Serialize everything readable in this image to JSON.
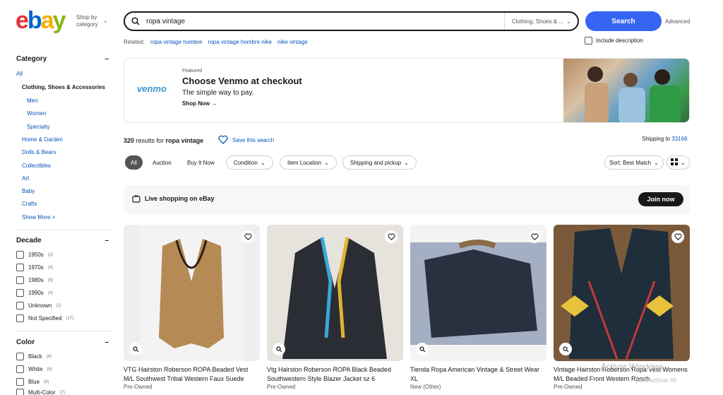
{
  "header": {
    "logo": {
      "e": "e",
      "b": "b",
      "a": "a",
      "y": "y"
    },
    "shop_by": "Shop by",
    "category": "category",
    "search_value": "ropa vintage",
    "category_select": "Clothing, Shoes & ...",
    "search_button": "Search",
    "advanced": "Advanced",
    "related_label": "Related:",
    "related": [
      "ropa vintage hombre",
      "ropa vintage hombre nike",
      "nike vintage"
    ],
    "include_description": "Include description"
  },
  "sidebar": {
    "category_title": "Category",
    "all": "All",
    "selected_category": "Clothing, Shoes & Accessories",
    "sub": [
      "Men",
      "Women",
      "Specialty"
    ],
    "others": [
      "Home & Garden",
      "Dolls & Bears",
      "Collectibles",
      "Art",
      "Baby",
      "Crafts"
    ],
    "show_more": "Show More",
    "decade_title": "Decade",
    "decades": [
      {
        "label": "1950s",
        "count": "(2)"
      },
      {
        "label": "1970s",
        "count": "(4)"
      },
      {
        "label": "1980s",
        "count": "(9)"
      },
      {
        "label": "1990s",
        "count": "(4)"
      },
      {
        "label": "Unknown",
        "count": "(2)"
      },
      {
        "label": "Not Specified",
        "count": "(17)"
      }
    ],
    "color_title": "Color",
    "colors": [
      {
        "label": "Black",
        "count": "(4)"
      },
      {
        "label": "White",
        "count": "(6)"
      },
      {
        "label": "Blue",
        "count": "(6)"
      },
      {
        "label": "Multi-Color",
        "count": "(7)"
      }
    ]
  },
  "banner": {
    "brand": "venmo",
    "featured": "Featured",
    "title": "Choose Venmo at checkout",
    "subtitle": "The simple way to pay.",
    "cta": "Shop Now →"
  },
  "results": {
    "count": "320",
    "text": "results for",
    "query": "ropa vintage",
    "save_search": "Save this search",
    "shipping_to": "Shipping to",
    "zip": "33166"
  },
  "filters": {
    "all": "All",
    "auction": "Auction",
    "buy_it_now": "Buy It Now",
    "condition": "Condition",
    "item_location": "Item Location",
    "shipping_pickup": "Shipping and pickup",
    "sort": "Sort: Best Match"
  },
  "live": {
    "text": "Live shopping on eBay",
    "join": "Join now"
  },
  "products": [
    {
      "title": "VTG Hairston Roberson ROPA Beaded Vest M/L Southwest Tribal Western Faux Suede",
      "condition": "Pre-Owned"
    },
    {
      "title": "Vtg Hairston Roberson ROPA Black Beaded Southwestern Style Blazer Jacket sz 6",
      "condition": "Pre-Owned"
    },
    {
      "title": "Tienda Ropa American Vintage & Street Wear XL",
      "condition": "New (Other)"
    },
    {
      "title": "Vintage Hairston Roberson Ropa Vest Womens M/L Beaded Front Western Ranch",
      "condition": "Pre-Owned"
    }
  ],
  "watermark": {
    "line1": "Activar Windows",
    "line2": "para activar W"
  }
}
